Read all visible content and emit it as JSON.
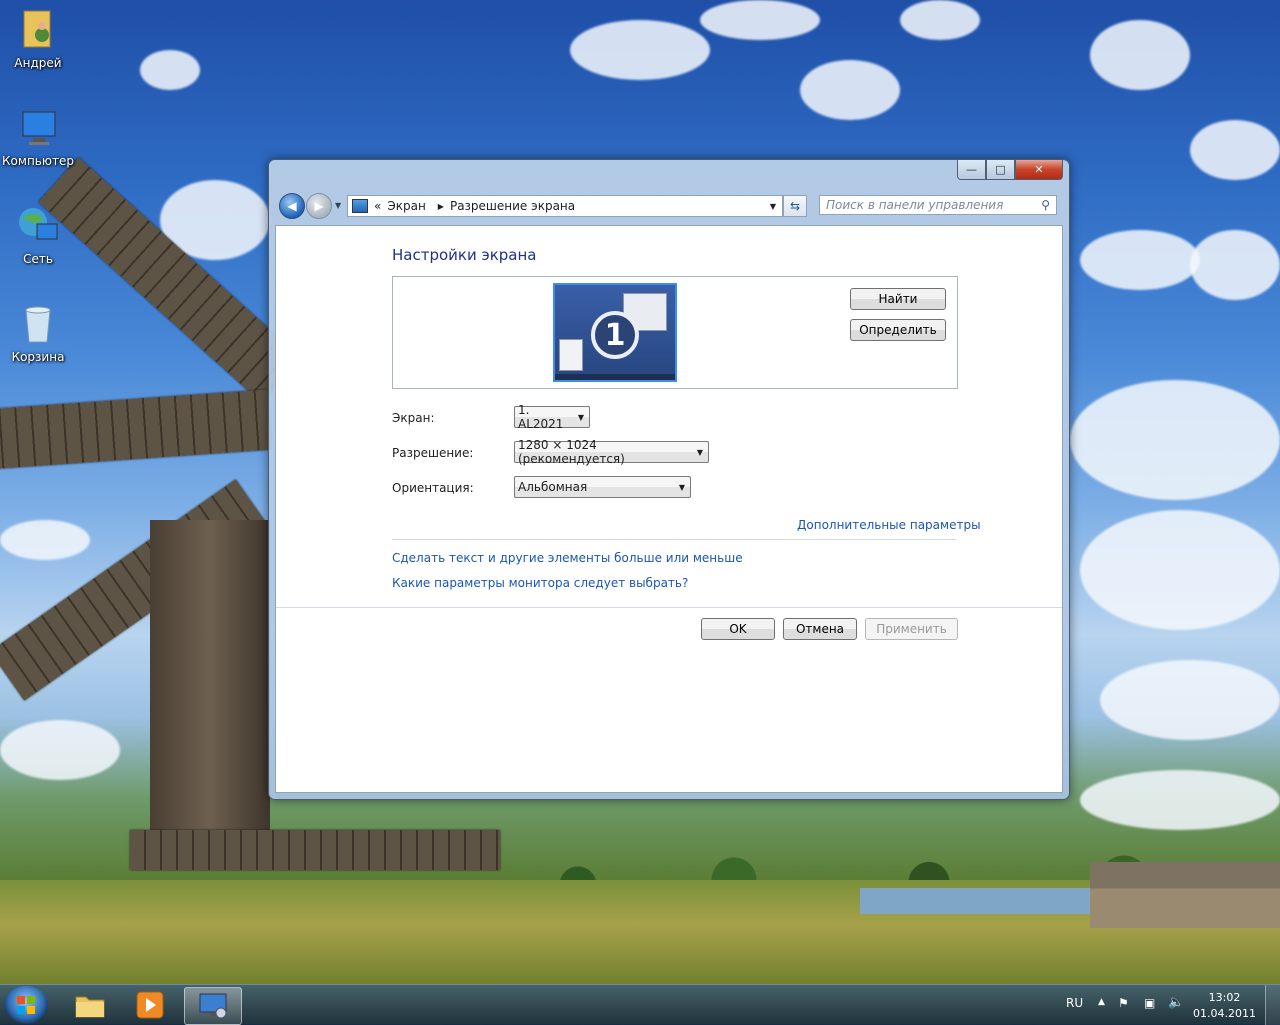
{
  "desktop": {
    "icons": [
      {
        "label": "Андрей"
      },
      {
        "label": "Компьютер"
      },
      {
        "label": "Сеть"
      },
      {
        "label": "Корзина"
      }
    ]
  },
  "window": {
    "caption_buttons": {
      "minimize": "—",
      "maximize": "□",
      "close": "✕"
    },
    "address": {
      "prefix": "«",
      "crumbs": [
        "Экран",
        "Разрешение экрана"
      ]
    },
    "search": {
      "placeholder": "Поиск в панели управления"
    },
    "heading": "Настройки экрана",
    "monitor_number": "1",
    "buttons": {
      "detect": "Найти",
      "identify": "Определить",
      "ok": "OK",
      "cancel": "Отмена",
      "apply": "Применить"
    },
    "fields": {
      "display": {
        "label": "Экран:",
        "value": "1. AL2021"
      },
      "resolution": {
        "label": "Разрешение:",
        "value": "1280 × 1024 (рекомендуется)"
      },
      "orientation": {
        "label": "Ориентация:",
        "value": "Альбомная"
      }
    },
    "links": {
      "advanced": "Дополнительные параметры",
      "text_size": "Сделать текст и другие элементы больше или меньше",
      "which_settings": "Какие параметры монитора следует выбрать?"
    }
  },
  "taskbar": {
    "language": "RU",
    "time": "13:02",
    "date": "01.04.2011"
  }
}
